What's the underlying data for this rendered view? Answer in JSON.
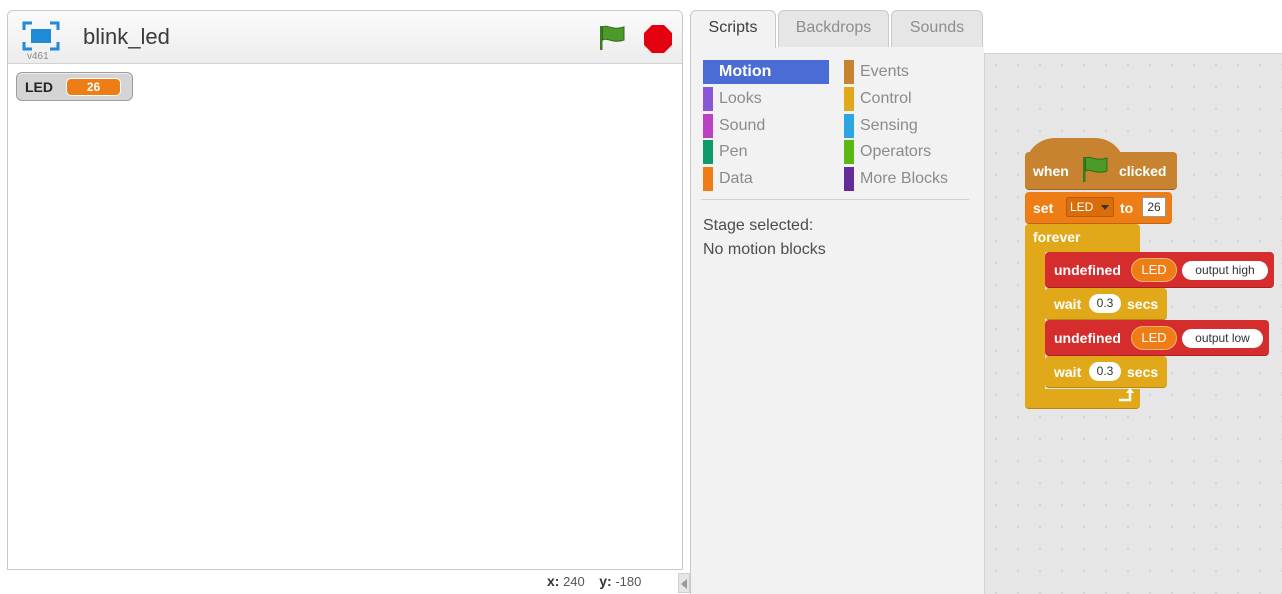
{
  "stage": {
    "project_title": "blink_led",
    "version": "v461",
    "monitor": {
      "label": "LED",
      "value": "26"
    },
    "coords": {
      "x_label": "x:",
      "x_value": "240",
      "y_label": "y:",
      "y_value": "-180"
    }
  },
  "tabs": [
    {
      "label": "Scripts",
      "selected": true
    },
    {
      "label": "Backdrops",
      "selected": false
    },
    {
      "label": "Sounds",
      "selected": false
    }
  ],
  "categories": [
    {
      "label": "Motion",
      "color": "#4a6cd4",
      "selected": true
    },
    {
      "label": "Looks",
      "color": "#8a55d7"
    },
    {
      "label": "Sound",
      "color": "#bb42c3"
    },
    {
      "label": "Pen",
      "color": "#0e9a6c"
    },
    {
      "label": "Data",
      "color": "#ee7d16"
    },
    {
      "label": "Events",
      "color": "#c88330"
    },
    {
      "label": "Control",
      "color": "#e1a91a"
    },
    {
      "label": "Sensing",
      "color": "#2ca5e2"
    },
    {
      "label": "Operators",
      "color": "#5cb712"
    },
    {
      "label": "More Blocks",
      "color": "#632d99"
    }
  ],
  "palette_message": {
    "line1": "Stage selected:",
    "line2": "No motion blocks"
  },
  "script": {
    "hat": {
      "when": "when",
      "clicked": "clicked"
    },
    "set": {
      "label": "set",
      "variable": "LED",
      "to": "to",
      "value": "26"
    },
    "forever": {
      "label": "forever"
    },
    "output_high": {
      "label": "undefined",
      "pin": "LED",
      "state": "output high"
    },
    "wait1": {
      "label": "wait",
      "value": "0.3",
      "unit": "secs"
    },
    "output_low": {
      "label": "undefined",
      "pin": "LED",
      "state": "output low"
    },
    "wait2": {
      "label": "wait",
      "value": "0.3",
      "unit": "secs"
    }
  },
  "colors": {
    "motion": "#4a6cd4",
    "events": "#c88330",
    "control": "#e1a91a",
    "data": "#ee7d16",
    "extension": "#d52d2d",
    "green_flag": "#3f8a2a",
    "stop": "#e3000f"
  },
  "icons": [
    "fullscreen-icon",
    "green-flag-icon",
    "stop-icon",
    "dropdown-arrow-icon",
    "loop-arrow-icon",
    "collapse-arrow-icon"
  ]
}
